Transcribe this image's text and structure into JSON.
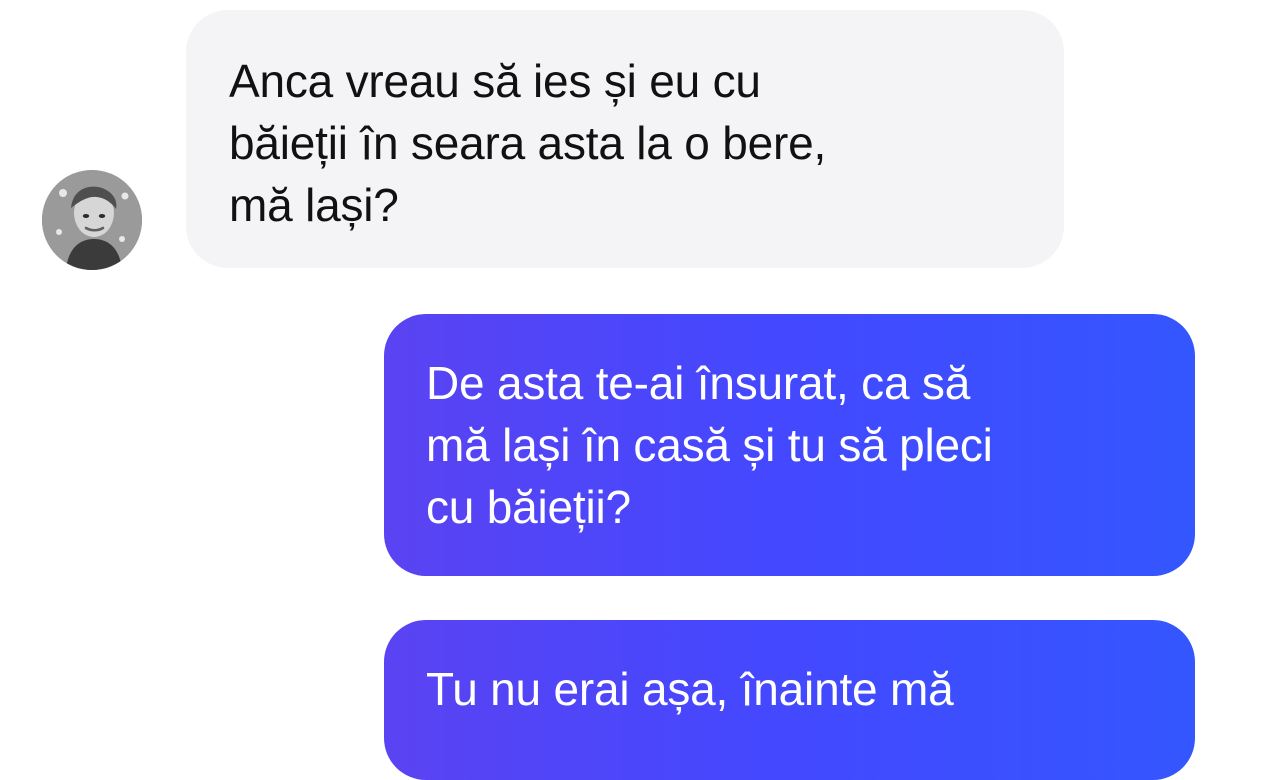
{
  "conversation": {
    "incoming_message": {
      "lines": [
        "Anca vreau să ies și eu cu",
        "băieții în seara asta la o bere,",
        "mă lași?"
      ]
    },
    "outgoing_messages": [
      {
        "lines": [
          "De asta te-ai însurat, ca să",
          "mă lași în casă și tu să pleci",
          "cu băieții?"
        ]
      },
      {
        "lines": [
          "Tu nu erai așa, înainte mă"
        ]
      }
    ]
  },
  "icons": {
    "avatar": "profile-avatar-icon"
  },
  "colors": {
    "background": "#ffffff",
    "incoming_bubble": "#f4f4f6",
    "incoming_text": "#111111",
    "outgoing_bubble_start": "#5a43f2",
    "outgoing_bubble_end": "#3456ff",
    "outgoing_text": "#ffffff"
  }
}
